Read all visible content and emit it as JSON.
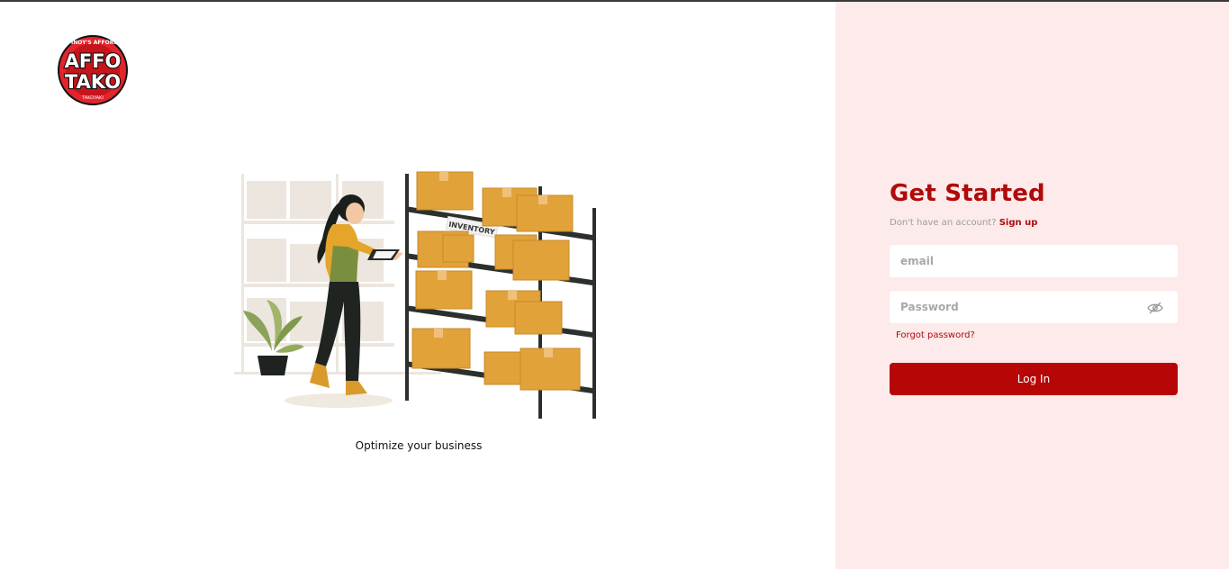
{
  "brand": {
    "logo_top_text": "PINOY'S AFFORD",
    "logo_line1": "AFFO",
    "logo_line2": "TAKO",
    "logo_bottom_text": "TAKOYAKI",
    "primary_color": "#b10a0a",
    "panel_color": "#fdeaea"
  },
  "illustration": {
    "shelf_label": "INVENTORY"
  },
  "left": {
    "tagline": "Optimize your business"
  },
  "auth": {
    "title": "Get Started",
    "no_account_text": "Don't have an account?",
    "signup_label": "Sign up",
    "email_placeholder": "email",
    "password_placeholder": "Password",
    "password_toggle_icon": "eye-off-icon",
    "forgot_label": "Forgot password?",
    "login_label": "Log In"
  }
}
